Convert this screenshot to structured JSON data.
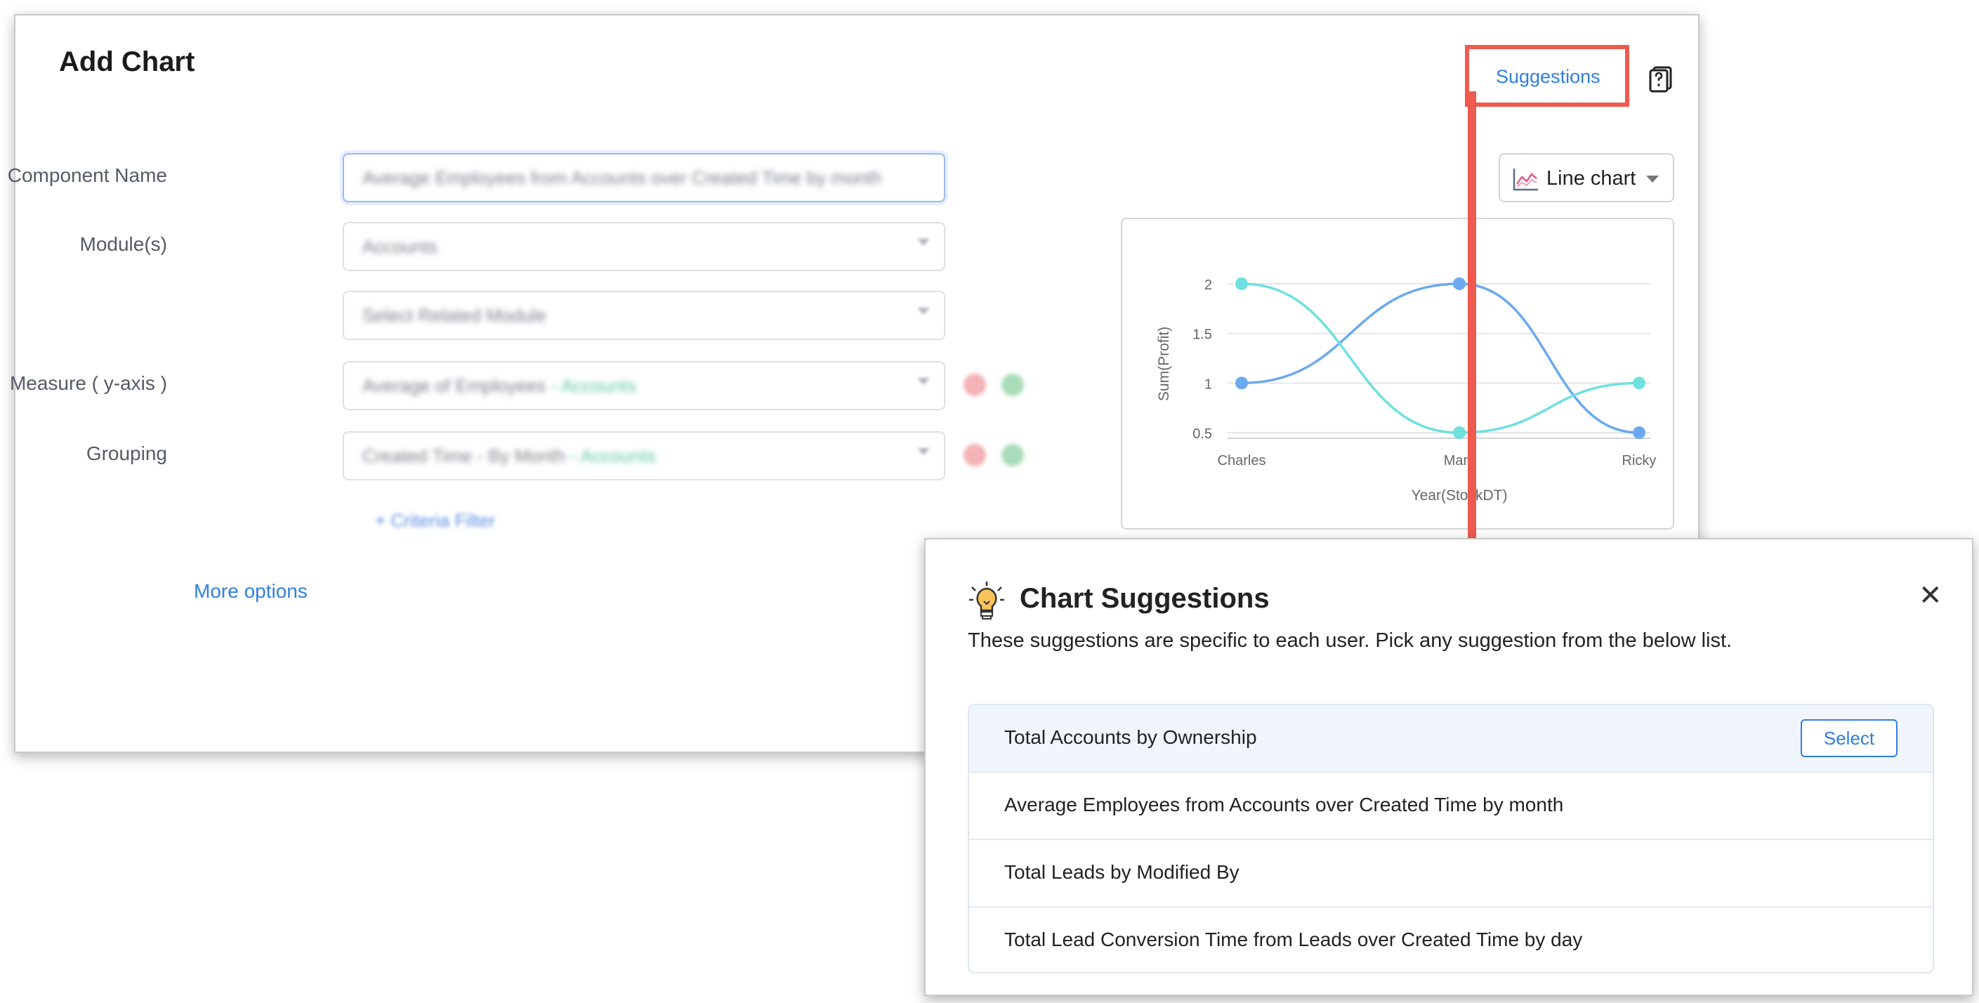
{
  "add_chart": {
    "title": "Add Chart",
    "suggestions_label": "Suggestions",
    "help_icon": "document-question-icon",
    "form": {
      "component_name_label": "Component Name",
      "component_name_value": "Average Employees from Accounts over Created Time by month",
      "modules_label": "Module(s)",
      "modules_value": "Accounts",
      "related_module_placeholder": "Select Related Module",
      "measure_label": "Measure ( y-axis )",
      "measure_value": "Average of Employees",
      "measure_module": "- Accounts",
      "grouping_label": "Grouping",
      "grouping_value": "Created Time - By Month",
      "grouping_module": "- Accounts",
      "criteria_filter_label": "+ Criteria Filter",
      "more_options_label": "More options"
    },
    "chart_type": {
      "label": "Line chart",
      "icon": "line-chart-icon"
    }
  },
  "chart_data": {
    "type": "line",
    "categories": [
      "Charles",
      "Mary",
      "Ricky"
    ],
    "series": [
      {
        "values": [
          1,
          2,
          0.5
        ],
        "color": "#6aa9ef"
      },
      {
        "values": [
          2,
          0.5,
          1
        ],
        "color": "#6fe0e0"
      }
    ],
    "yticks": [
      "2",
      "1.5",
      "1",
      "0.5"
    ],
    "ylim": [
      0.5,
      2
    ],
    "xlabel": "Year(StockDT)",
    "ylabel": "Sum(Profit)",
    "grid": true
  },
  "suggestions_panel": {
    "title": "Chart Suggestions",
    "icon": "lightbulb-icon",
    "description": "These suggestions are specific to each user. Pick any suggestion from the below list.",
    "select_label": "Select",
    "items": [
      "Total Accounts by Ownership",
      "Average Employees from Accounts over Created Time by month",
      "Total Leads by Modified By",
      "Total Lead Conversion Time from Leads over Created Time by day"
    ]
  },
  "colors": {
    "accent": "#2f7fe0",
    "highlight": "#ee5a4e",
    "series_1": "#6aa9ef",
    "series_2": "#6fe0e0"
  }
}
